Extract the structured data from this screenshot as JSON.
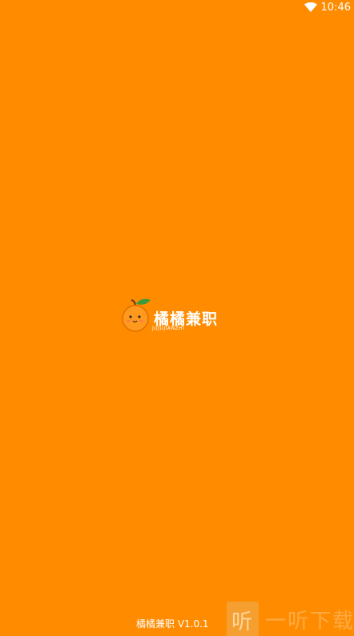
{
  "status_bar": {
    "time": "10:46",
    "wifi_icon": "wifi-icon"
  },
  "splash": {
    "background_color": "#FF8C00",
    "logo_icon": "orange-fruit-icon",
    "app_name": "橘橘兼职",
    "app_subtitle": "JUJUJIANZHI",
    "version": "橘橘兼职 V1.0.1"
  },
  "watermark": {
    "logo_char": "听",
    "text": "一听下载"
  }
}
